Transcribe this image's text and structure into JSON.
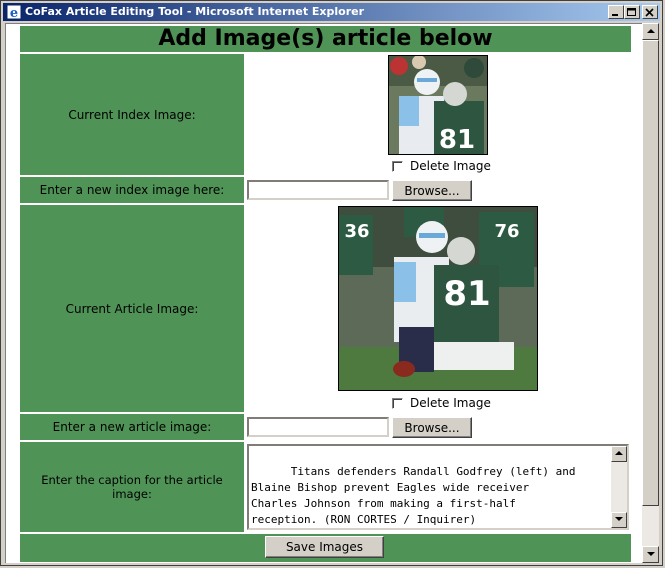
{
  "window": {
    "title": "CoFax Article Editing Tool - Microsoft Internet Explorer"
  },
  "page": {
    "heading": "Add Image(s) article below",
    "index_image": {
      "label": "Current Index Image:",
      "delete_label": "Delete Image",
      "delete_checked": false
    },
    "new_index": {
      "label": "Enter a new index image here:",
      "value": "",
      "browse_label": "Browse..."
    },
    "article_image": {
      "label": "Current Article Image:",
      "delete_label": "Delete Image",
      "delete_checked": false
    },
    "new_article": {
      "label": "Enter a new article image:",
      "value": "",
      "browse_label": "Browse..."
    },
    "caption": {
      "label": "Enter the caption for the article image:",
      "value": "Titans defenders Randall Godfrey (left) and\nBlaine Bishop prevent Eagles wide receiver\nCharles Johnson from making a first-half\nreception. (RON CORTES / Inquirer)"
    },
    "save_label": "Save Images"
  },
  "colors": {
    "cell_green": "#4f9456",
    "titlebar_start": "#0a246a",
    "titlebar_end": "#a6caf0"
  },
  "icons": [
    "ie-icon",
    "minimize-icon",
    "maximize-icon",
    "close-icon",
    "scroll-up-icon",
    "scroll-down-icon"
  ]
}
